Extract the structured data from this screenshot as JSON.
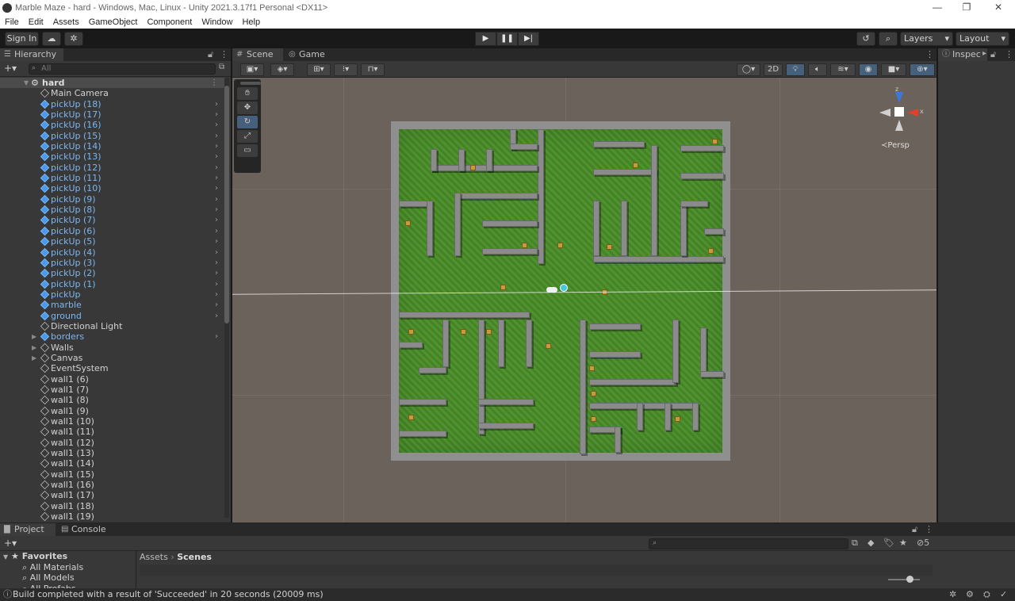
{
  "window": {
    "title": "Marble Maze - hard - Windows, Mac, Linux - Unity 2021.3.17f1 Personal <DX11>",
    "controls": [
      "—",
      "❐",
      "✕"
    ]
  },
  "menu": [
    "File",
    "Edit",
    "Assets",
    "GameObject",
    "Component",
    "Window",
    "Help"
  ],
  "toolbar": {
    "sign_in": "Sign In",
    "layers": "Layers",
    "layout": "Layout"
  },
  "hierarchy": {
    "tab": "Hierarchy",
    "search_placeholder": "All",
    "scene_name": "hard",
    "items": [
      {
        "label": "Main Camera",
        "prefab": false,
        "arrow": false,
        "fold": false
      },
      {
        "label": "pickUp (18)",
        "prefab": true,
        "arrow": true,
        "fold": false
      },
      {
        "label": "pickUp (17)",
        "prefab": true,
        "arrow": true,
        "fold": false
      },
      {
        "label": "pickUp (16)",
        "prefab": true,
        "arrow": true,
        "fold": false
      },
      {
        "label": "pickUp (15)",
        "prefab": true,
        "arrow": true,
        "fold": false
      },
      {
        "label": "pickUp (14)",
        "prefab": true,
        "arrow": true,
        "fold": false
      },
      {
        "label": "pickUp (13)",
        "prefab": true,
        "arrow": true,
        "fold": false
      },
      {
        "label": "pickUp (12)",
        "prefab": true,
        "arrow": true,
        "fold": false
      },
      {
        "label": "pickUp (11)",
        "prefab": true,
        "arrow": true,
        "fold": false
      },
      {
        "label": "pickUp (10)",
        "prefab": true,
        "arrow": true,
        "fold": false
      },
      {
        "label": "pickUp (9)",
        "prefab": true,
        "arrow": true,
        "fold": false
      },
      {
        "label": "pickUp (8)",
        "prefab": true,
        "arrow": true,
        "fold": false
      },
      {
        "label": "pickUp (7)",
        "prefab": true,
        "arrow": true,
        "fold": false
      },
      {
        "label": "pickUp (6)",
        "prefab": true,
        "arrow": true,
        "fold": false
      },
      {
        "label": "pickUp (5)",
        "prefab": true,
        "arrow": true,
        "fold": false
      },
      {
        "label": "pickUp (4)",
        "prefab": true,
        "arrow": true,
        "fold": false
      },
      {
        "label": "pickUp (3)",
        "prefab": true,
        "arrow": true,
        "fold": false
      },
      {
        "label": "pickUp (2)",
        "prefab": true,
        "arrow": true,
        "fold": false
      },
      {
        "label": "pickUp (1)",
        "prefab": true,
        "arrow": true,
        "fold": false
      },
      {
        "label": "pickUp",
        "prefab": true,
        "arrow": true,
        "fold": false
      },
      {
        "label": "marble",
        "prefab": true,
        "arrow": true,
        "fold": false
      },
      {
        "label": "ground",
        "prefab": true,
        "arrow": true,
        "fold": false
      },
      {
        "label": "Directional Light",
        "prefab": false,
        "arrow": false,
        "fold": false
      },
      {
        "label": "borders",
        "prefab": true,
        "arrow": true,
        "fold": true
      },
      {
        "label": "Walls",
        "prefab": false,
        "arrow": false,
        "fold": true
      },
      {
        "label": "Canvas",
        "prefab": false,
        "arrow": false,
        "fold": true
      },
      {
        "label": "EventSystem",
        "prefab": false,
        "arrow": false,
        "fold": false
      },
      {
        "label": "wall1 (6)",
        "prefab": false,
        "arrow": false,
        "fold": false
      },
      {
        "label": "wall1 (7)",
        "prefab": false,
        "arrow": false,
        "fold": false
      },
      {
        "label": "wall1 (8)",
        "prefab": false,
        "arrow": false,
        "fold": false
      },
      {
        "label": "wall1 (9)",
        "prefab": false,
        "arrow": false,
        "fold": false
      },
      {
        "label": "wall1 (10)",
        "prefab": false,
        "arrow": false,
        "fold": false
      },
      {
        "label": "wall1 (11)",
        "prefab": false,
        "arrow": false,
        "fold": false
      },
      {
        "label": "wall1 (12)",
        "prefab": false,
        "arrow": false,
        "fold": false
      },
      {
        "label": "wall1 (13)",
        "prefab": false,
        "arrow": false,
        "fold": false
      },
      {
        "label": "wall1 (14)",
        "prefab": false,
        "arrow": false,
        "fold": false
      },
      {
        "label": "wall1 (15)",
        "prefab": false,
        "arrow": false,
        "fold": false
      },
      {
        "label": "wall1 (16)",
        "prefab": false,
        "arrow": false,
        "fold": false
      },
      {
        "label": "wall1 (17)",
        "prefab": false,
        "arrow": false,
        "fold": false
      },
      {
        "label": "wall1 (18)",
        "prefab": false,
        "arrow": false,
        "fold": false
      },
      {
        "label": "wall1 (19)",
        "prefab": false,
        "arrow": false,
        "fold": false
      }
    ]
  },
  "scene": {
    "tabs": [
      "Scene",
      "Game"
    ],
    "mode_2d": "2D",
    "persp_label": "Persp",
    "axis_z": "z",
    "axis_x": "x"
  },
  "inspector": {
    "tab": "Inspec"
  },
  "project": {
    "tabs": [
      "Project",
      "Console"
    ],
    "breadcrumb": [
      "Assets",
      "Scenes"
    ],
    "favorites_title": "Favorites",
    "favorites": [
      "All Materials",
      "All Models",
      "All Prefabs"
    ],
    "hidden_count": "5"
  },
  "status": {
    "message": "Build completed with a result of 'Succeeded' in 20 seconds (20009 ms)"
  }
}
